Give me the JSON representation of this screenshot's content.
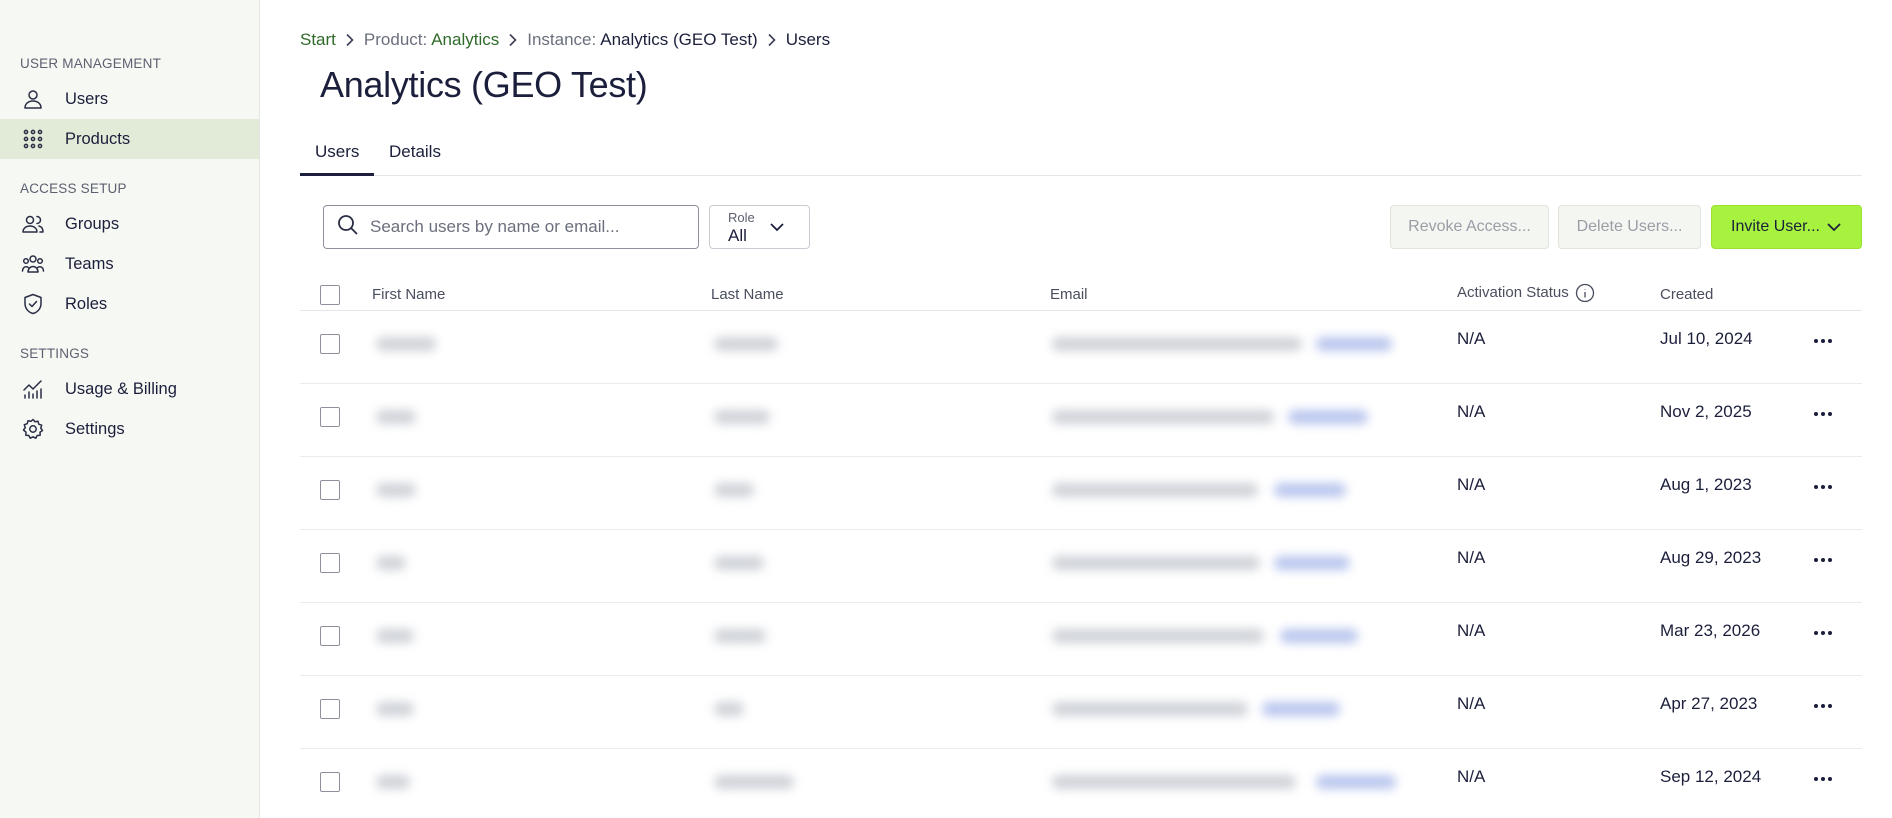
{
  "sidebar": {
    "sections": [
      {
        "title": "USER MANAGEMENT",
        "items": [
          {
            "label": "Users",
            "icon": "user-icon"
          },
          {
            "label": "Products",
            "icon": "grid-icon"
          }
        ]
      },
      {
        "title": "ACCESS SETUP",
        "items": [
          {
            "label": "Groups",
            "icon": "group-icon"
          },
          {
            "label": "Teams",
            "icon": "teams-icon"
          },
          {
            "label": "Roles",
            "icon": "shield-check-icon"
          }
        ]
      },
      {
        "title": "SETTINGS",
        "items": [
          {
            "label": "Usage & Billing",
            "icon": "chart-icon"
          },
          {
            "label": "Settings",
            "icon": "gear-icon"
          }
        ]
      }
    ],
    "active_item": "Products"
  },
  "breadcrumb": {
    "start": "Start",
    "product_prefix": "Product:",
    "product": "Analytics",
    "instance_prefix": "Instance:",
    "instance": "Analytics (GEO Test)",
    "current": "Users"
  },
  "page": {
    "title": "Analytics (GEO Test)"
  },
  "tabs": [
    {
      "label": "Users",
      "active": true
    },
    {
      "label": "Details",
      "active": false
    }
  ],
  "toolbar": {
    "search_placeholder": "Search users by name or email...",
    "role_caption": "Role",
    "role_value": "All",
    "revoke_label": "Revoke Access...",
    "delete_label": "Delete Users...",
    "invite_label": "Invite User..."
  },
  "colors": {
    "accent": "#a6f23e",
    "sidebar_active": "#e2ead8",
    "link": "#2f6a2b",
    "text": "#1b1f3b"
  },
  "table": {
    "columns": [
      "First Name",
      "Last Name",
      "Email",
      "Activation Status",
      "Created"
    ],
    "rows": [
      {
        "status": "N/A",
        "created": "Jul 10, 2024"
      },
      {
        "status": "N/A",
        "created": "Nov 2, 2025"
      },
      {
        "status": "N/A",
        "created": "Aug 1, 2023"
      },
      {
        "status": "N/A",
        "created": "Aug 29, 2023"
      },
      {
        "status": "N/A",
        "created": "Mar 23, 2026"
      },
      {
        "status": "N/A",
        "created": "Apr 27, 2023"
      },
      {
        "status": "N/A",
        "created": "Sep 12, 2024"
      }
    ]
  }
}
